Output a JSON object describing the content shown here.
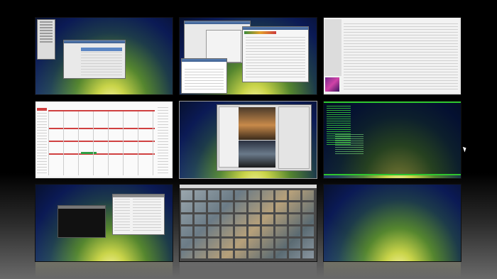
{
  "desktop": {
    "cursor_icon": "arrow-pointer-icon",
    "colors": {
      "background": "#000000",
      "calendar_accent": "#d04040",
      "terminal_accent": "#2ec52e",
      "selection": "#3d5f90"
    }
  }
}
